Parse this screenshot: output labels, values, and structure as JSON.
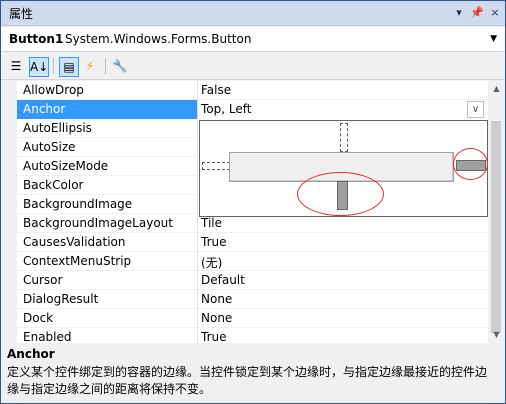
{
  "window": {
    "title": "属性",
    "buttons": [
      "▾",
      "📌",
      "×"
    ]
  },
  "object": {
    "name": "Button1",
    "type": "System.Windows.Forms.Button"
  },
  "toolbar": {
    "items": [
      "categorized-icon",
      "alphabetical-icon",
      "properties-icon",
      "events-icon",
      "property-pages-icon"
    ]
  },
  "grid": {
    "rows": [
      {
        "name": "AllowDrop",
        "value": "False"
      },
      {
        "name": "Anchor",
        "value": "Top, Left"
      },
      {
        "name": "AutoEllipsis",
        "value": ""
      },
      {
        "name": "AutoSize",
        "value": ""
      },
      {
        "name": "AutoSizeMode",
        "value": ""
      },
      {
        "name": "BackColor",
        "value": ""
      },
      {
        "name": "BackgroundImage",
        "value": ""
      },
      {
        "name": "BackgroundImageLayout",
        "value": "Tile"
      },
      {
        "name": "CausesValidation",
        "value": "True"
      },
      {
        "name": "ContextMenuStrip",
        "value": "(无)"
      },
      {
        "name": "Cursor",
        "value": "Default"
      },
      {
        "name": "DialogResult",
        "value": "None"
      },
      {
        "name": "Dock",
        "value": "None"
      },
      {
        "name": "Enabled",
        "value": "True"
      }
    ]
  },
  "description": {
    "title": "Anchor",
    "text": "定义某个控件绑定到的容器的边缘。当控件锁定到某个边缘时，与指定边缘最接近的控件边缘与指定边缘之间的距离将保持不变。"
  }
}
